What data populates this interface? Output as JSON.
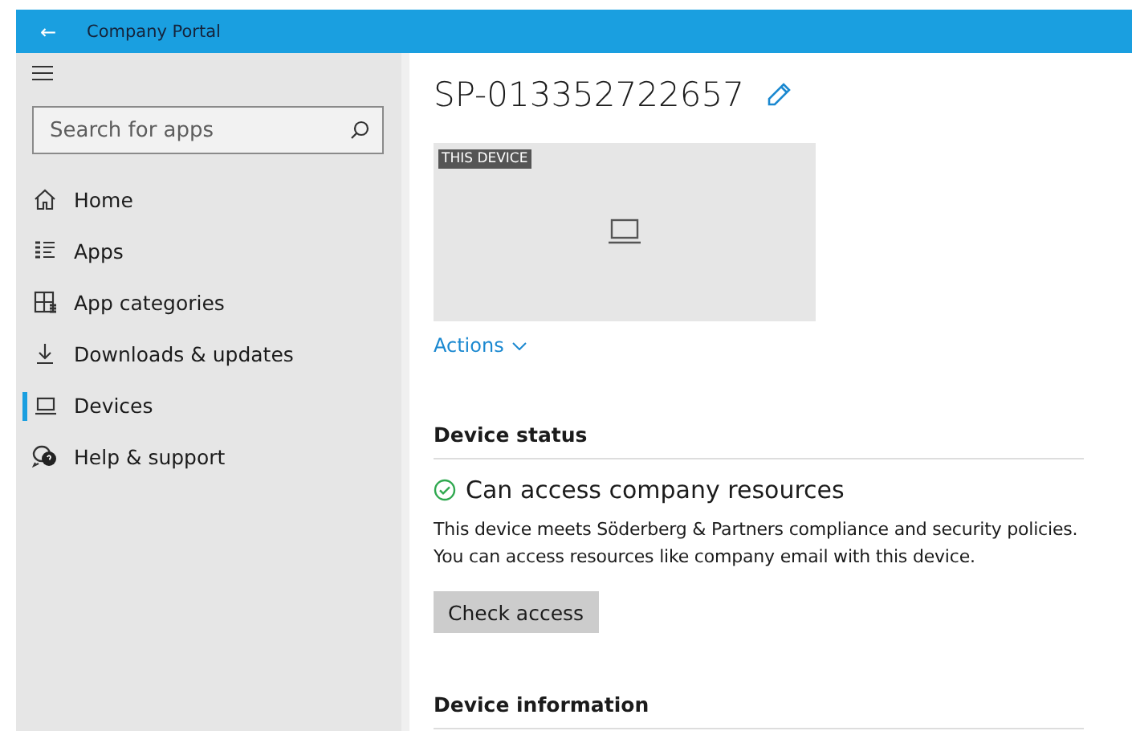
{
  "window": {
    "title": "Company Portal",
    "back_glyph": "←"
  },
  "sidebar": {
    "search": {
      "placeholder": "Search for apps"
    },
    "items": [
      {
        "label": "Home",
        "selected": false
      },
      {
        "label": "Apps",
        "selected": false
      },
      {
        "label": "App categories",
        "selected": false
      },
      {
        "label": "Downloads & updates",
        "selected": false
      },
      {
        "label": "Devices",
        "selected": true
      },
      {
        "label": "Help & support",
        "selected": false
      }
    ]
  },
  "device": {
    "name": "SP-013352722657",
    "tile_badge": "THIS DEVICE",
    "actions": "Actions"
  },
  "status": {
    "heading": "Device status",
    "state": "Can access company resources",
    "compliant": true,
    "description": "This device meets Söderberg & Partners compliance and security policies. You can access resources like company email with this device.",
    "button": "Check access"
  },
  "info": {
    "heading": "Device information"
  }
}
